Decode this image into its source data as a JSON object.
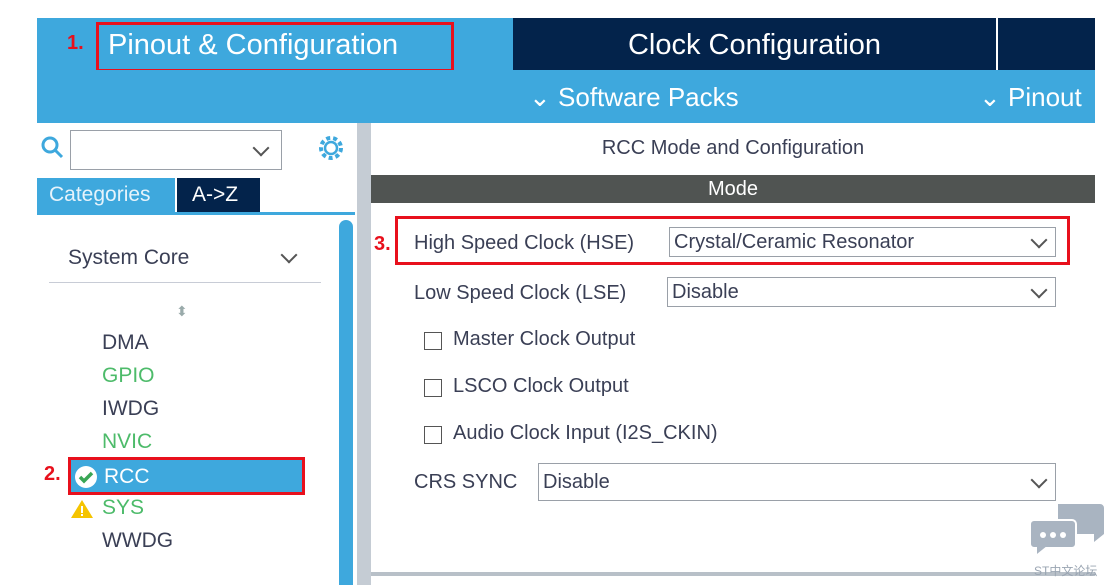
{
  "tabs": [
    {
      "label": "Pinout & Configuration",
      "step": "1."
    },
    {
      "label": "Clock Configuration"
    }
  ],
  "subnav": [
    {
      "label": "Software Packs"
    },
    {
      "label": "Pinout"
    }
  ],
  "sidebar": {
    "search_value": "",
    "tab_categories": "Categories",
    "tab_az": "A->Z",
    "group": "System Core",
    "items": [
      {
        "label": "DMA",
        "status": "none"
      },
      {
        "label": "GPIO",
        "status": "ok"
      },
      {
        "label": "IWDG",
        "status": "none"
      },
      {
        "label": "NVIC",
        "status": "ok"
      },
      {
        "label": "RCC",
        "status": "checked",
        "selected": true,
        "step": "2."
      },
      {
        "label": "SYS",
        "status": "warning"
      },
      {
        "label": "WWDG",
        "status": "none"
      }
    ]
  },
  "panel": {
    "title": "RCC Mode and Configuration",
    "section": "Mode",
    "hse": {
      "label": "High Speed Clock (HSE)",
      "value": "Crystal/Ceramic Resonator",
      "step": "3."
    },
    "lse": {
      "label": "Low Speed Clock (LSE)",
      "value": "Disable"
    },
    "checkboxes": [
      {
        "label": "Master Clock Output",
        "checked": false
      },
      {
        "label": "LSCO Clock Output",
        "checked": false
      },
      {
        "label": "Audio Clock Input (I2S_CKIN)",
        "checked": false
      }
    ],
    "crs": {
      "label": "CRS SYNC",
      "value": "Disable"
    }
  },
  "watermark": "ST中文论坛",
  "colors": {
    "accent": "#3ea8dd",
    "navy": "#03234b",
    "highlight": "#e8101c",
    "green": "#4dbb6a",
    "warning": "#f5c400"
  }
}
